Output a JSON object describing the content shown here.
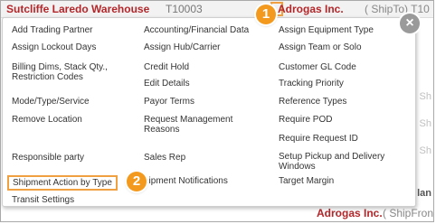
{
  "background": {
    "warehouse_name": "Sutcliffe Laredo Warehouse",
    "warehouse_code": "T10003",
    "partner_name": "Adrogas Inc.",
    "partner_role": "( ShipTo) T10",
    "partner_name_2": "Adrogas Inc.",
    "partner_role_2": "( ShipFron",
    "edge_fragments": [
      "Sh",
      "Sh",
      "Sh",
      "lan"
    ]
  },
  "callouts": {
    "first": "1",
    "second": "2"
  },
  "close_label": "×",
  "menu": {
    "column1": [
      "Add Trading Partner",
      "Assign Lockout Days",
      "Billing Dims, Stack Qty., Restriction Codes",
      "Mode/Type/Service",
      "Remove Location",
      "Responsible party",
      "Shipment Action by Type",
      "Transit Settings"
    ],
    "column2": [
      "Accounting/Financial Data",
      "Assign Hub/Carrier",
      "Credit Hold",
      "Edit Details",
      "Payor Terms",
      "Request Management Reasons",
      "Sales Rep",
      "hipment Notifications"
    ],
    "column3": [
      "Assign Equipment Type",
      "Assign Team or Solo",
      "Customer GL Code",
      "Tracking Priority",
      "Reference Types",
      "Require POD",
      "Require Request ID",
      "Setup Pickup and Delivery Windows",
      "Target Margin"
    ]
  }
}
